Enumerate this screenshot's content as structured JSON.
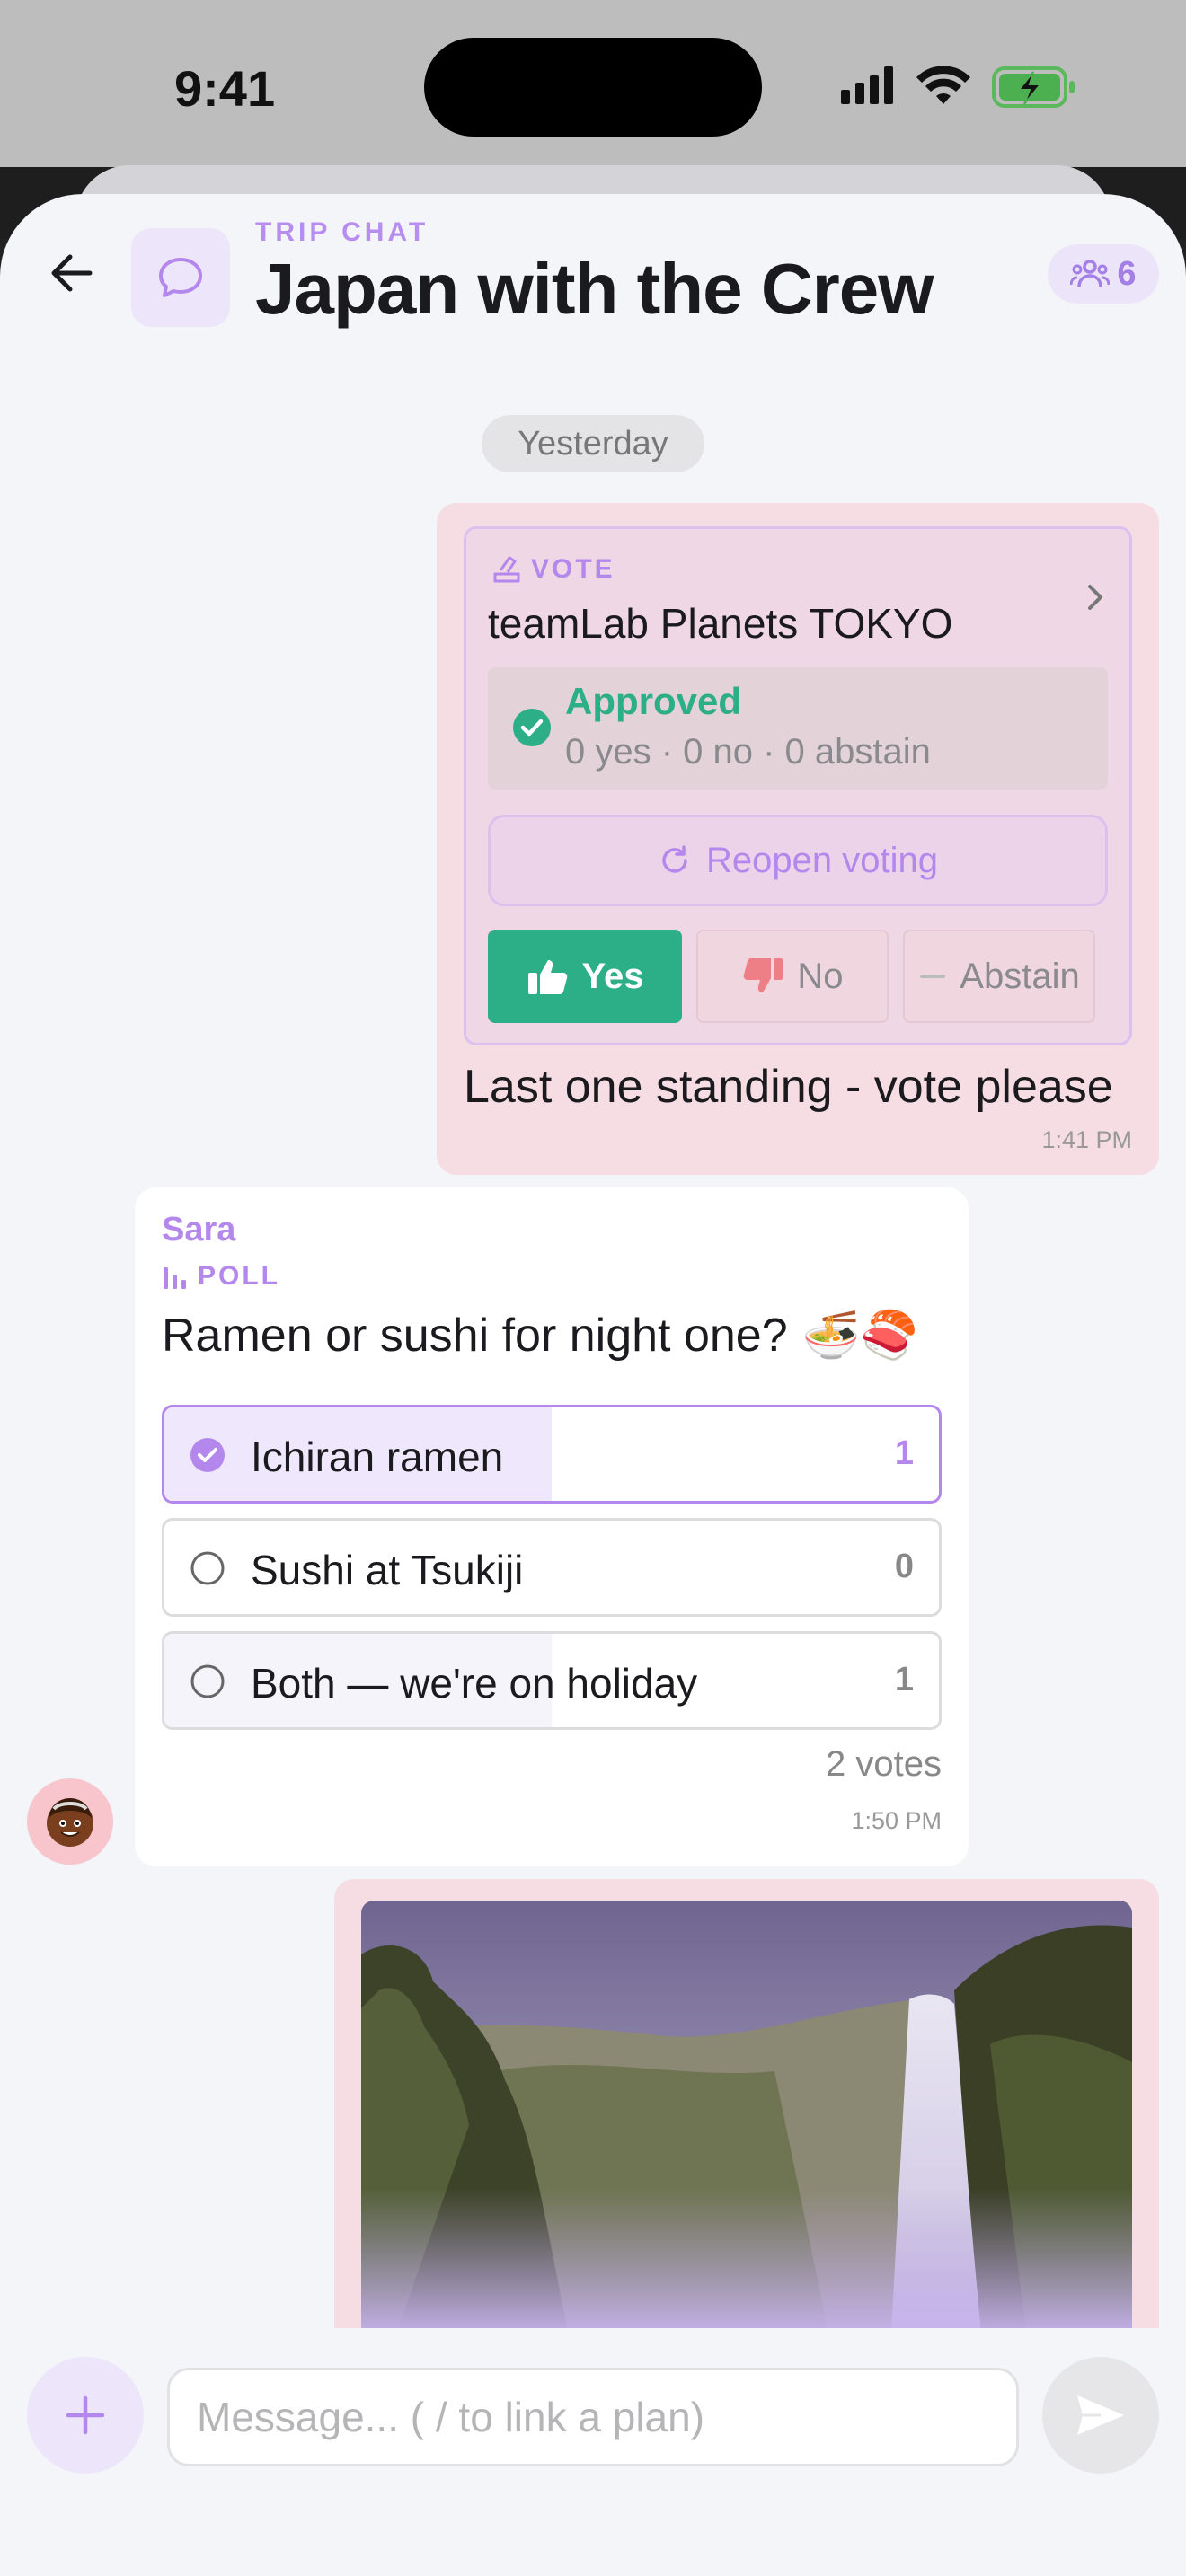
{
  "status_bar": {
    "time": "9:41",
    "icons": [
      "signal-icon",
      "wifi-icon",
      "battery-charging-icon"
    ]
  },
  "header": {
    "label": "TRIP CHAT",
    "title": "Japan with the Crew",
    "member_count": "6",
    "icons": [
      "back-arrow-icon",
      "chat-bubble-icon",
      "members-icon"
    ]
  },
  "date_divider": "Yesterday",
  "vote_message": {
    "tag": "VOTE",
    "title": "teamLab Planets TOKYO",
    "status": "Approved",
    "counts": "0 yes · 0 no · 0 abstain",
    "reopen_label": "Reopen voting",
    "yes_label": "Yes",
    "no_label": "No",
    "abstain_label": "Abstain",
    "text": "Last one standing - vote please",
    "time": "1:41 PM"
  },
  "poll_message": {
    "sender": "Sara",
    "tag": "POLL",
    "question": "Ramen or sushi for night one?",
    "emoji": "🍜🍣",
    "options": [
      {
        "label": "Ichiran ramen",
        "count": "1",
        "selected": true,
        "share": 0.5
      },
      {
        "label": "Sushi at Tsukiji",
        "count": "0",
        "selected": false,
        "share": 0
      },
      {
        "label": "Both — we're on holiday",
        "count": "1",
        "selected": false,
        "share": 0.5
      }
    ],
    "total": "2 votes",
    "time": "1:50 PM"
  },
  "image_message": {
    "subject": "waterfall-photo"
  },
  "composer": {
    "placeholder": "Message... ( / to link a plan)"
  },
  "colors": {
    "accent": "#b487ec",
    "approved": "#2cae87",
    "own_bubble": "#f5dde3"
  }
}
